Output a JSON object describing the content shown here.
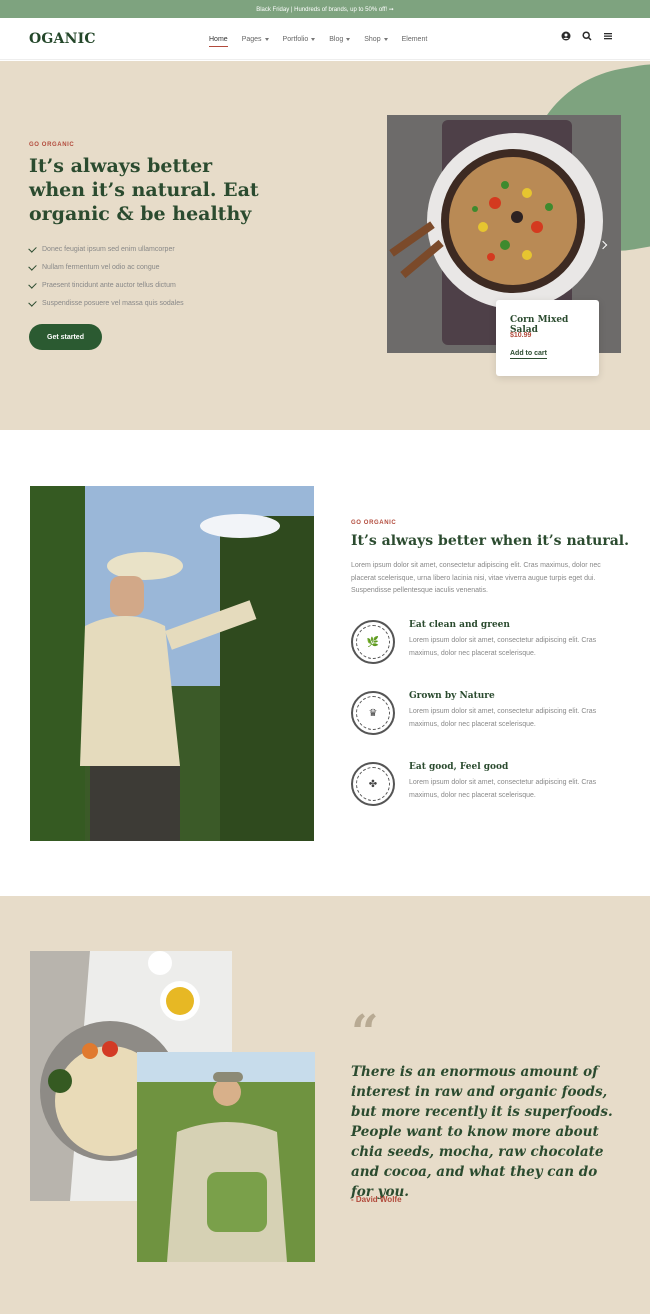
{
  "topbar": {
    "text": "Black Friday | Hundreds of brands, up to 50% off! ➞"
  },
  "header": {
    "logo": "OGANIC",
    "nav": [
      {
        "label": "Home",
        "active": true,
        "dropdown": false
      },
      {
        "label": "Pages",
        "active": false,
        "dropdown": true
      },
      {
        "label": "Portfolio",
        "active": false,
        "dropdown": true
      },
      {
        "label": "Blog",
        "active": false,
        "dropdown": true
      },
      {
        "label": "Shop",
        "active": false,
        "dropdown": true
      },
      {
        "label": "Element",
        "active": false,
        "dropdown": false
      }
    ],
    "icons": [
      "user-icon",
      "search-icon",
      "menu-icon"
    ]
  },
  "hero": {
    "eyebrow": "GO ORGANIC",
    "title": "It’s always better when it’s natural. Eat organic & be healthy",
    "bullets": [
      "Donec feugiat ipsum sed enim ullamcorper",
      "Nullam fermentum vel odio ac congue",
      "Praesent tincidunt ante auctor tellus dictum",
      "Suspendisse posuere vel massa quis sodales"
    ],
    "cta": "Get started",
    "product": {
      "name": "Corn Mixed Salad",
      "price": "$10.99",
      "cart": "Add to cart"
    }
  },
  "about": {
    "eyebrow": "GO ORGANIC",
    "title": "It’s always better when it’s natural.",
    "text": "Lorem ipsum dolor sit amet, consectetur adipiscing elit. Cras maximus, dolor nec placerat scelerisque, urna libero lacinia nisi, vitae viverra augue turpis eget dui. Suspendisse pellentesque iaculis venenatis.",
    "features": [
      {
        "title": "Eat clean and green",
        "text": "Lorem ipsum dolor sit amet, consectetur adipiscing elit. Cras maximus, dolor nec placerat scelerisque.",
        "badge": "QUALITY ORGANIC"
      },
      {
        "title": "Grown by Nature",
        "text": "Lorem ipsum dolor sit amet, consectetur adipiscing elit. Cras maximus, dolor nec placerat scelerisque.",
        "badge": "PREMIUM QUALITY"
      },
      {
        "title": "Eat good, Feel good",
        "text": "Lorem ipsum dolor sit amet, consectetur adipiscing elit. Cras maximus, dolor nec placerat scelerisque.",
        "badge": "ORGANIC FOOD"
      }
    ]
  },
  "testimonial": {
    "quote": "There is an enormous amount of interest in raw and organic foods, but more recently it is superfoods. People want to know more about chia seeds, mocha, raw chocolate and cocoa, and what they can do for you.",
    "author": "- David Wolfe"
  },
  "colors": {
    "green": "#2b4b2f",
    "sage": "#7ea37f",
    "beige": "#e7dcc9",
    "red": "#b24b3c"
  }
}
